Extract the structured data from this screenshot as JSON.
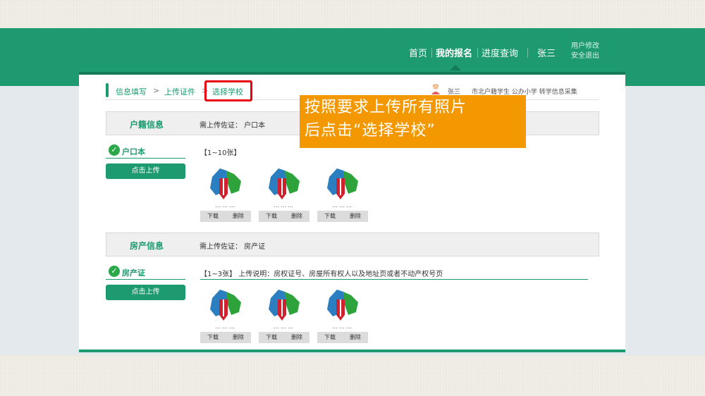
{
  "nav": {
    "home": "首页",
    "my_registration": "我的报名",
    "progress_query": "进度查询",
    "username": "张三",
    "user_modify": "用户修改",
    "logout": "安全退出"
  },
  "breadcrumb": {
    "step1": "信息填写",
    "step2": "上传证件",
    "step3": "选择学校",
    "separator": ">"
  },
  "user_info": {
    "name": "张三",
    "description": "市北户籍学生 公办小学 转学信息采集"
  },
  "sections": [
    {
      "title": "户籍信息",
      "required": "需上传佐证：  户口本",
      "doc_label": "户口本",
      "upload_label": "点击上传",
      "count": "【1~10张】",
      "thumbs": [
        {
          "download": "下载",
          "delete": "删除"
        },
        {
          "download": "下载",
          "delete": "删除"
        },
        {
          "download": "下载",
          "delete": "删除"
        }
      ]
    },
    {
      "title": "房产信息",
      "required": "需上传佐证：  房产证",
      "doc_label": "房产证",
      "upload_label": "点击上传",
      "count": "【1~3张】  上传说明：房权证号、房屋所有权人以及地址页或者不动产权号页",
      "thumbs": [
        {
          "download": "下载",
          "delete": "删除"
        },
        {
          "download": "下载",
          "delete": "删除"
        },
        {
          "download": "下载",
          "delete": "删除"
        }
      ]
    }
  ],
  "callout": {
    "line1": "按照要求上传所有照片",
    "line2": "后点击“选择学校”"
  },
  "colors": {
    "brand_green": "#1d9a70",
    "dark_green": "#157a57",
    "callout_orange": "#f39800",
    "highlight_red": "#e60012"
  }
}
